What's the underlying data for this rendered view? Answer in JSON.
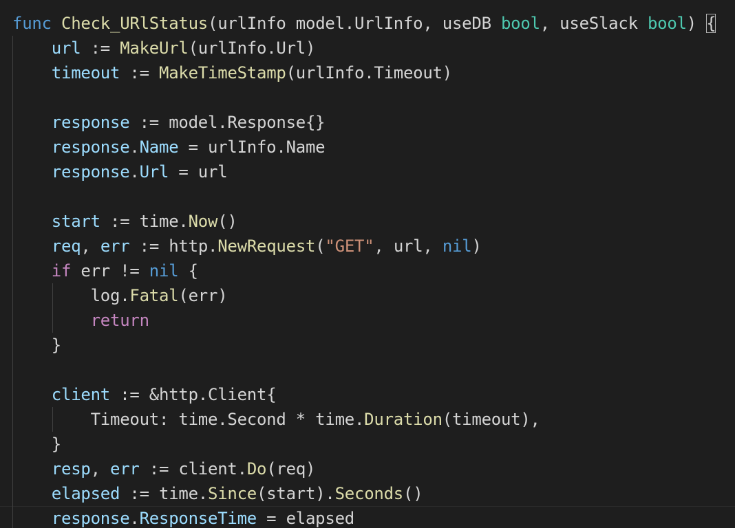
{
  "editor": {
    "language": "go",
    "theme_colors": {
      "background": "#1e1e1e",
      "keyword": "#569cd6",
      "control": "#c586c0",
      "function": "#dcdcaa",
      "type": "#4ec9b0",
      "variable": "#9cdcfe",
      "string": "#ce9178",
      "plain": "#d4d4d4"
    },
    "lines": [
      {
        "indent": "",
        "tokens": [
          {
            "c": "kw",
            "t": "func"
          },
          {
            "c": "plain",
            "t": " "
          },
          {
            "c": "fn",
            "t": "Check_URlStatus"
          },
          {
            "c": "plain",
            "t": "(urlInfo model.UrlInfo, useDB "
          },
          {
            "c": "type",
            "t": "bool"
          },
          {
            "c": "plain",
            "t": ", useSlack "
          },
          {
            "c": "type",
            "t": "bool"
          },
          {
            "c": "plain",
            "t": ") "
          },
          {
            "c": "bracket",
            "t": "{"
          }
        ]
      },
      {
        "indent": "    ",
        "tokens": [
          {
            "c": "var",
            "t": "url"
          },
          {
            "c": "plain",
            "t": " := "
          },
          {
            "c": "fn",
            "t": "MakeUrl"
          },
          {
            "c": "plain",
            "t": "(urlInfo.Url)"
          }
        ]
      },
      {
        "indent": "    ",
        "tokens": [
          {
            "c": "var",
            "t": "timeout"
          },
          {
            "c": "plain",
            "t": " := "
          },
          {
            "c": "fn",
            "t": "MakeTimeStamp"
          },
          {
            "c": "plain",
            "t": "(urlInfo.Timeout)"
          }
        ]
      },
      {
        "indent": "",
        "tokens": []
      },
      {
        "indent": "    ",
        "tokens": [
          {
            "c": "var",
            "t": "response"
          },
          {
            "c": "plain",
            "t": " := model.Response{}"
          }
        ]
      },
      {
        "indent": "    ",
        "tokens": [
          {
            "c": "var",
            "t": "response"
          },
          {
            "c": "plain",
            "t": "."
          },
          {
            "c": "var",
            "t": "Name"
          },
          {
            "c": "plain",
            "t": " = urlInfo.Name"
          }
        ]
      },
      {
        "indent": "    ",
        "tokens": [
          {
            "c": "var",
            "t": "response"
          },
          {
            "c": "plain",
            "t": "."
          },
          {
            "c": "var",
            "t": "Url"
          },
          {
            "c": "plain",
            "t": " = url"
          }
        ]
      },
      {
        "indent": "",
        "tokens": []
      },
      {
        "indent": "    ",
        "tokens": [
          {
            "c": "var",
            "t": "start"
          },
          {
            "c": "plain",
            "t": " := time."
          },
          {
            "c": "fn",
            "t": "Now"
          },
          {
            "c": "plain",
            "t": "()"
          }
        ]
      },
      {
        "indent": "    ",
        "tokens": [
          {
            "c": "var",
            "t": "req"
          },
          {
            "c": "plain",
            "t": ", "
          },
          {
            "c": "var",
            "t": "err"
          },
          {
            "c": "plain",
            "t": " := http."
          },
          {
            "c": "fn",
            "t": "NewRequest"
          },
          {
            "c": "plain",
            "t": "("
          },
          {
            "c": "str",
            "t": "\"GET\""
          },
          {
            "c": "plain",
            "t": ", url, "
          },
          {
            "c": "kw",
            "t": "nil"
          },
          {
            "c": "plain",
            "t": ")"
          }
        ]
      },
      {
        "indent": "    ",
        "tokens": [
          {
            "c": "ctrl",
            "t": "if"
          },
          {
            "c": "plain",
            "t": " err != "
          },
          {
            "c": "kw",
            "t": "nil"
          },
          {
            "c": "plain",
            "t": " {"
          }
        ]
      },
      {
        "indent": "        ",
        "tokens": [
          {
            "c": "plain",
            "t": "log."
          },
          {
            "c": "fn",
            "t": "Fatal"
          },
          {
            "c": "plain",
            "t": "(err)"
          }
        ]
      },
      {
        "indent": "        ",
        "tokens": [
          {
            "c": "ctrl",
            "t": "return"
          }
        ]
      },
      {
        "indent": "    ",
        "tokens": [
          {
            "c": "plain",
            "t": "}"
          }
        ]
      },
      {
        "indent": "",
        "tokens": []
      },
      {
        "indent": "    ",
        "tokens": [
          {
            "c": "var",
            "t": "client"
          },
          {
            "c": "plain",
            "t": " := &http.Client{"
          }
        ]
      },
      {
        "indent": "        ",
        "tokens": [
          {
            "c": "plain",
            "t": "Timeout: time.Second * time."
          },
          {
            "c": "fn",
            "t": "Duration"
          },
          {
            "c": "plain",
            "t": "(timeout),"
          }
        ]
      },
      {
        "indent": "    ",
        "tokens": [
          {
            "c": "plain",
            "t": "}"
          }
        ]
      },
      {
        "indent": "    ",
        "tokens": [
          {
            "c": "var",
            "t": "resp"
          },
          {
            "c": "plain",
            "t": ", "
          },
          {
            "c": "var",
            "t": "err"
          },
          {
            "c": "plain",
            "t": " := client."
          },
          {
            "c": "fn",
            "t": "Do"
          },
          {
            "c": "plain",
            "t": "(req)"
          }
        ]
      },
      {
        "indent": "    ",
        "tokens": [
          {
            "c": "var",
            "t": "elapsed"
          },
          {
            "c": "plain",
            "t": " := time."
          },
          {
            "c": "fn",
            "t": "Since"
          },
          {
            "c": "plain",
            "t": "(start)."
          },
          {
            "c": "fn",
            "t": "Seconds"
          },
          {
            "c": "plain",
            "t": "()"
          }
        ]
      },
      {
        "indent": "    ",
        "tokens": [
          {
            "c": "var",
            "t": "response"
          },
          {
            "c": "plain",
            "t": "."
          },
          {
            "c": "var",
            "t": "ResponseTime"
          },
          {
            "c": "plain",
            "t": " = elapsed"
          }
        ]
      }
    ]
  }
}
